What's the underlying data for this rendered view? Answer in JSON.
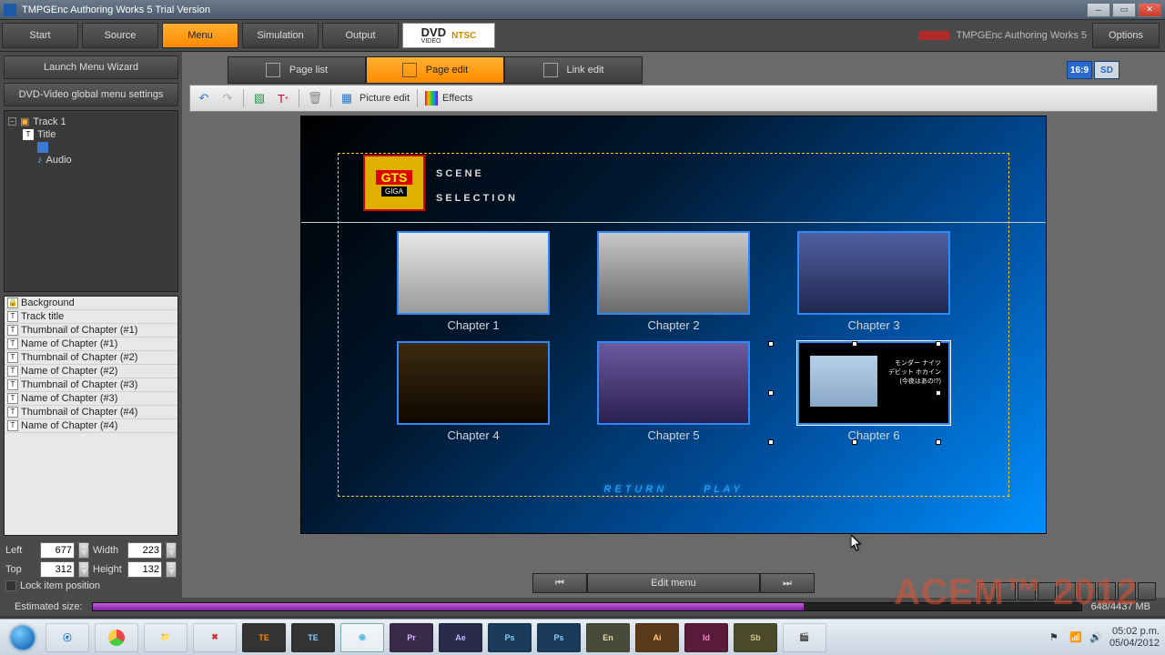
{
  "window": {
    "title": "TMPGEnc Authoring Works 5 Trial Version"
  },
  "mainTabs": {
    "start": "Start",
    "source": "Source",
    "menu": "Menu",
    "simulation": "Simulation",
    "output": "Output"
  },
  "dvdBadge": {
    "dvd": "DVD",
    "sub": "VIDEO",
    "ntsc": "NTSC"
  },
  "brand": "TMPGEnc Authoring Works 5",
  "options": "Options",
  "leftButtons": {
    "wizard": "Launch Menu Wizard",
    "global": "DVD-Video global menu settings"
  },
  "tree": {
    "track": "Track 1",
    "title": "Title",
    "audio": "Audio"
  },
  "layers": {
    "items": [
      {
        "icon": "🔒",
        "label": "Background"
      },
      {
        "icon": "T",
        "label": "Track title"
      },
      {
        "icon": "T",
        "label": "Thumbnail of Chapter (#1)"
      },
      {
        "icon": "T",
        "label": "Name of Chapter (#1)"
      },
      {
        "icon": "T",
        "label": "Thumbnail of Chapter (#2)"
      },
      {
        "icon": "T",
        "label": "Name of Chapter (#2)"
      },
      {
        "icon": "T",
        "label": "Thumbnail of Chapter (#3)"
      },
      {
        "icon": "T",
        "label": "Name of Chapter (#3)"
      },
      {
        "icon": "T",
        "label": "Thumbnail of Chapter (#4)"
      },
      {
        "icon": "T",
        "label": "Name of Chapter (#4)"
      }
    ]
  },
  "coords": {
    "leftLbl": "Left",
    "left": "677",
    "widthLbl": "Width",
    "width": "223",
    "topLbl": "Top",
    "top": "312",
    "heightLbl": "Height",
    "height": "132",
    "lock": "Lock item position"
  },
  "tabs": {
    "pagelist": "Page list",
    "pageedit": "Page edit",
    "linkedit": "Link edit"
  },
  "aspect": {
    "ratio": "16:9",
    "sd": "SD"
  },
  "editbar": {
    "pictureEdit": "Picture edit",
    "effects": "Effects"
  },
  "menu": {
    "logoTop": "GTS",
    "logoBot": "GIGA",
    "title1": "SCENE",
    "title2": "SELECTION",
    "chapters": [
      "Chapter 1",
      "Chapter 2",
      "Chapter 3",
      "Chapter 4",
      "Chapter 5",
      "Chapter 6"
    ],
    "return": "RETURN",
    "play": "PLAY"
  },
  "playbar": {
    "edit": "Edit menu"
  },
  "footer": {
    "label": "Estimated size:",
    "text": "648/4437 MB"
  },
  "watermark": "ACEM™ 2012",
  "clock": {
    "time": "05:02 p.m.",
    "date": "05/04/2012"
  },
  "adobe": {
    "pr": "Pr",
    "ae": "Ae",
    "ps1": "Ps",
    "ps2": "Ps",
    "en": "En",
    "ai": "Ai",
    "id": "Id",
    "sb": "Sb"
  }
}
